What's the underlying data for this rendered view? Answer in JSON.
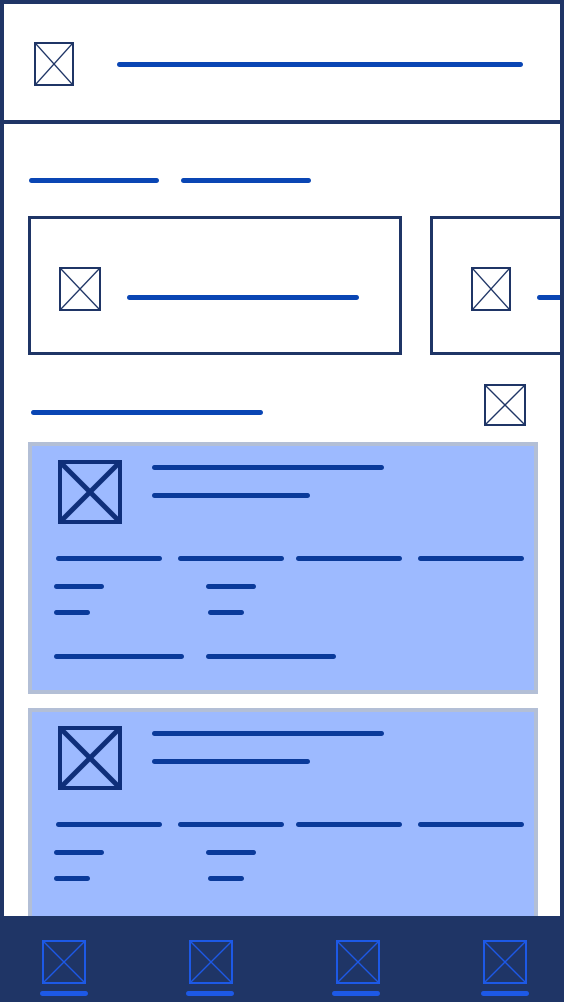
{
  "theme": {
    "border": "#1f3566",
    "accent": "#0a46b4",
    "card_fill": "#9dbaff",
    "card_border": "#b3bfd6",
    "nav_bg": "#1f3566",
    "nav_accent": "#1d59e6"
  },
  "header": {
    "icon": "image-placeholder-icon",
    "title": ""
  },
  "tabs": [
    {
      "label": ""
    },
    {
      "label": ""
    }
  ],
  "featured": [
    {
      "icon": "image-placeholder-icon",
      "label": ""
    },
    {
      "icon": "image-placeholder-icon",
      "label": ""
    }
  ],
  "section": {
    "title": "",
    "action_icon": "image-placeholder-icon"
  },
  "list": [
    {
      "thumb_icon": "image-placeholder-icon",
      "title": "",
      "subtitle": "",
      "stats": [
        "",
        "",
        "",
        ""
      ],
      "detail_a": [
        "",
        ""
      ],
      "detail_b": [
        "",
        ""
      ],
      "footer": [
        "",
        ""
      ]
    },
    {
      "thumb_icon": "image-placeholder-icon",
      "title": "",
      "subtitle": "",
      "stats": [
        "",
        "",
        "",
        ""
      ],
      "detail_a": [
        "",
        ""
      ],
      "detail_b": [
        "",
        ""
      ],
      "footer": [
        "",
        ""
      ]
    }
  ],
  "bottom_nav": [
    {
      "icon": "image-placeholder-icon",
      "label": ""
    },
    {
      "icon": "image-placeholder-icon",
      "label": ""
    },
    {
      "icon": "image-placeholder-icon",
      "label": ""
    },
    {
      "icon": "image-placeholder-icon",
      "label": ""
    }
  ]
}
